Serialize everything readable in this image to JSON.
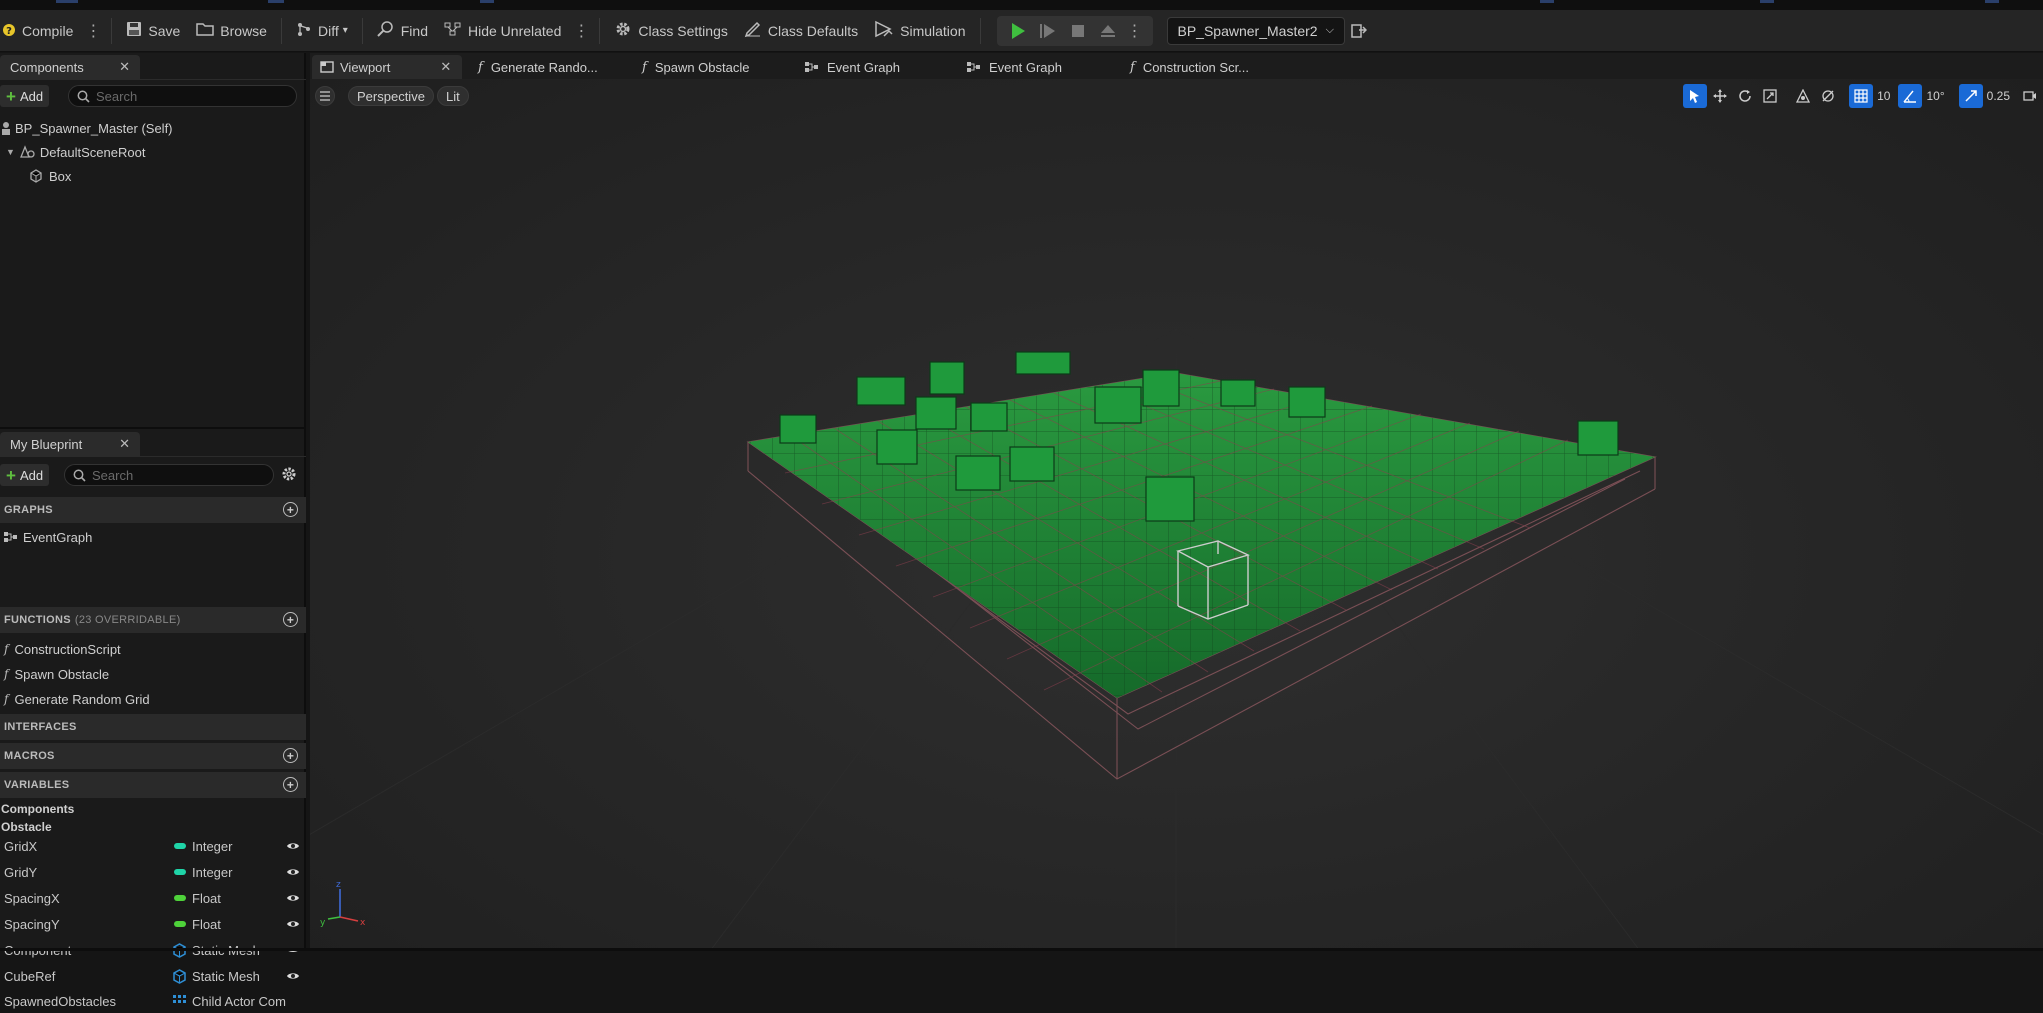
{
  "toolbar": {
    "compile": "Compile",
    "save": "Save",
    "browse": "Browse",
    "diff": "Diff",
    "find": "Find",
    "hide_unrelated": "Hide Unrelated",
    "class_settings": "Class Settings",
    "class_defaults": "Class Defaults",
    "simulation": "Simulation",
    "debug_object": "BP_Spawner_Master2"
  },
  "components_panel": {
    "title": "Components",
    "add": "Add",
    "search_placeholder": "Search",
    "tree": [
      {
        "label": "BP_Spawner_Master (Self)"
      },
      {
        "label": "DefaultSceneRoot"
      },
      {
        "label": "Box"
      }
    ]
  },
  "my_blueprint": {
    "title": "My Blueprint",
    "add": "Add",
    "search_placeholder": "Search",
    "graphs_header": "GRAPHS",
    "graphs": [
      "EventGraph"
    ],
    "functions_header": "FUNCTIONS",
    "functions_sub": "(23 OVERRIDABLE)",
    "functions": [
      "ConstructionScript",
      "Spawn Obstacle",
      "Generate Random Grid"
    ],
    "interfaces_header": "INTERFACES",
    "macros_header": "MACROS",
    "variables_header": "VARIABLES",
    "categories": [
      "Components",
      "Obstacle"
    ],
    "variables": [
      {
        "name": "GridX",
        "type": "Integer",
        "color": "#1fd4a8"
      },
      {
        "name": "GridY",
        "type": "Integer",
        "color": "#1fd4a8"
      },
      {
        "name": "SpacingX",
        "type": "Float",
        "color": "#4ed23a"
      },
      {
        "name": "SpacingY",
        "type": "Float",
        "color": "#4ed23a"
      },
      {
        "name": "Component",
        "type": "Static Mesh",
        "color": "#2e8fd6"
      },
      {
        "name": "CubeRef",
        "type": "Static Mesh",
        "color": "#2e8fd6"
      },
      {
        "name": "SpawnedObstacles",
        "type": "Child Actor Com",
        "color": "#2e8fd6"
      }
    ]
  },
  "doc_tabs": [
    {
      "label": "Viewport"
    },
    {
      "label": "Generate Rando..."
    },
    {
      "label": "Spawn Obstacle"
    },
    {
      "label": "Event Graph"
    },
    {
      "label": "Event Graph"
    },
    {
      "label": "Construction Scr..."
    }
  ],
  "viewport": {
    "perspective": "Perspective",
    "lit": "Lit",
    "grid_snap": "10",
    "rotation_snap": "10°",
    "scale_snap": "0.25"
  },
  "colors": {
    "accent_blue": "#1a6ad6",
    "play_green": "#3fbf3f",
    "floor_green": "#1f8a36"
  }
}
